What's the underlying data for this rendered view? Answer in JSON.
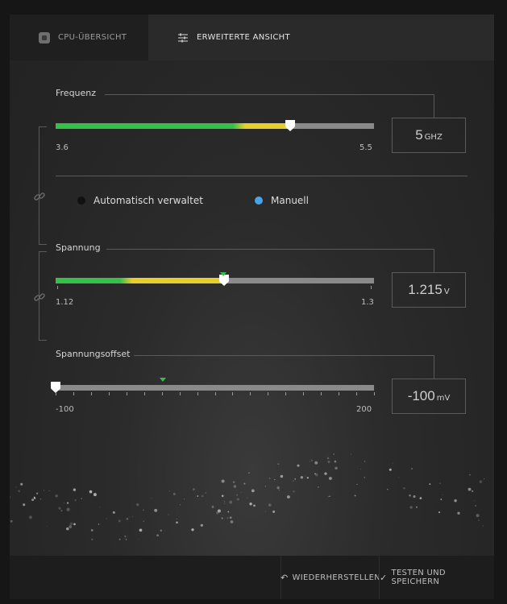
{
  "tabs": {
    "cpu_overview": "CPU-ÜBERSICHT",
    "advanced_view": "ERWEITERTE ANSICHT"
  },
  "frequency": {
    "label": "Frequenz",
    "min": "3.6",
    "max": "5.5",
    "value": "5",
    "unit": "GHZ",
    "level": 0.737
  },
  "mode": {
    "auto_label": "Automatisch verwaltet",
    "manual_label": "Manuell",
    "selected": "manual"
  },
  "voltage": {
    "label": "Spannung",
    "min": "1.12",
    "max": "1.3",
    "value": "1.215",
    "unit": "V",
    "level": 0.528
  },
  "voltage_offset": {
    "label": "Spannungsoffset",
    "min": "-100",
    "max": "200",
    "value": "-100",
    "unit": "mV",
    "level": 0.0
  },
  "footer": {
    "restore": "WIEDERHERSTELLEN",
    "test_save": "TESTEN UND SPEICHERN"
  },
  "colors": {
    "green": "#36c04a",
    "yellow": "#e6cf2c",
    "track": "#8a8a8a",
    "manual_dot": "#4aa3e6",
    "auto_dot": "#111111"
  }
}
